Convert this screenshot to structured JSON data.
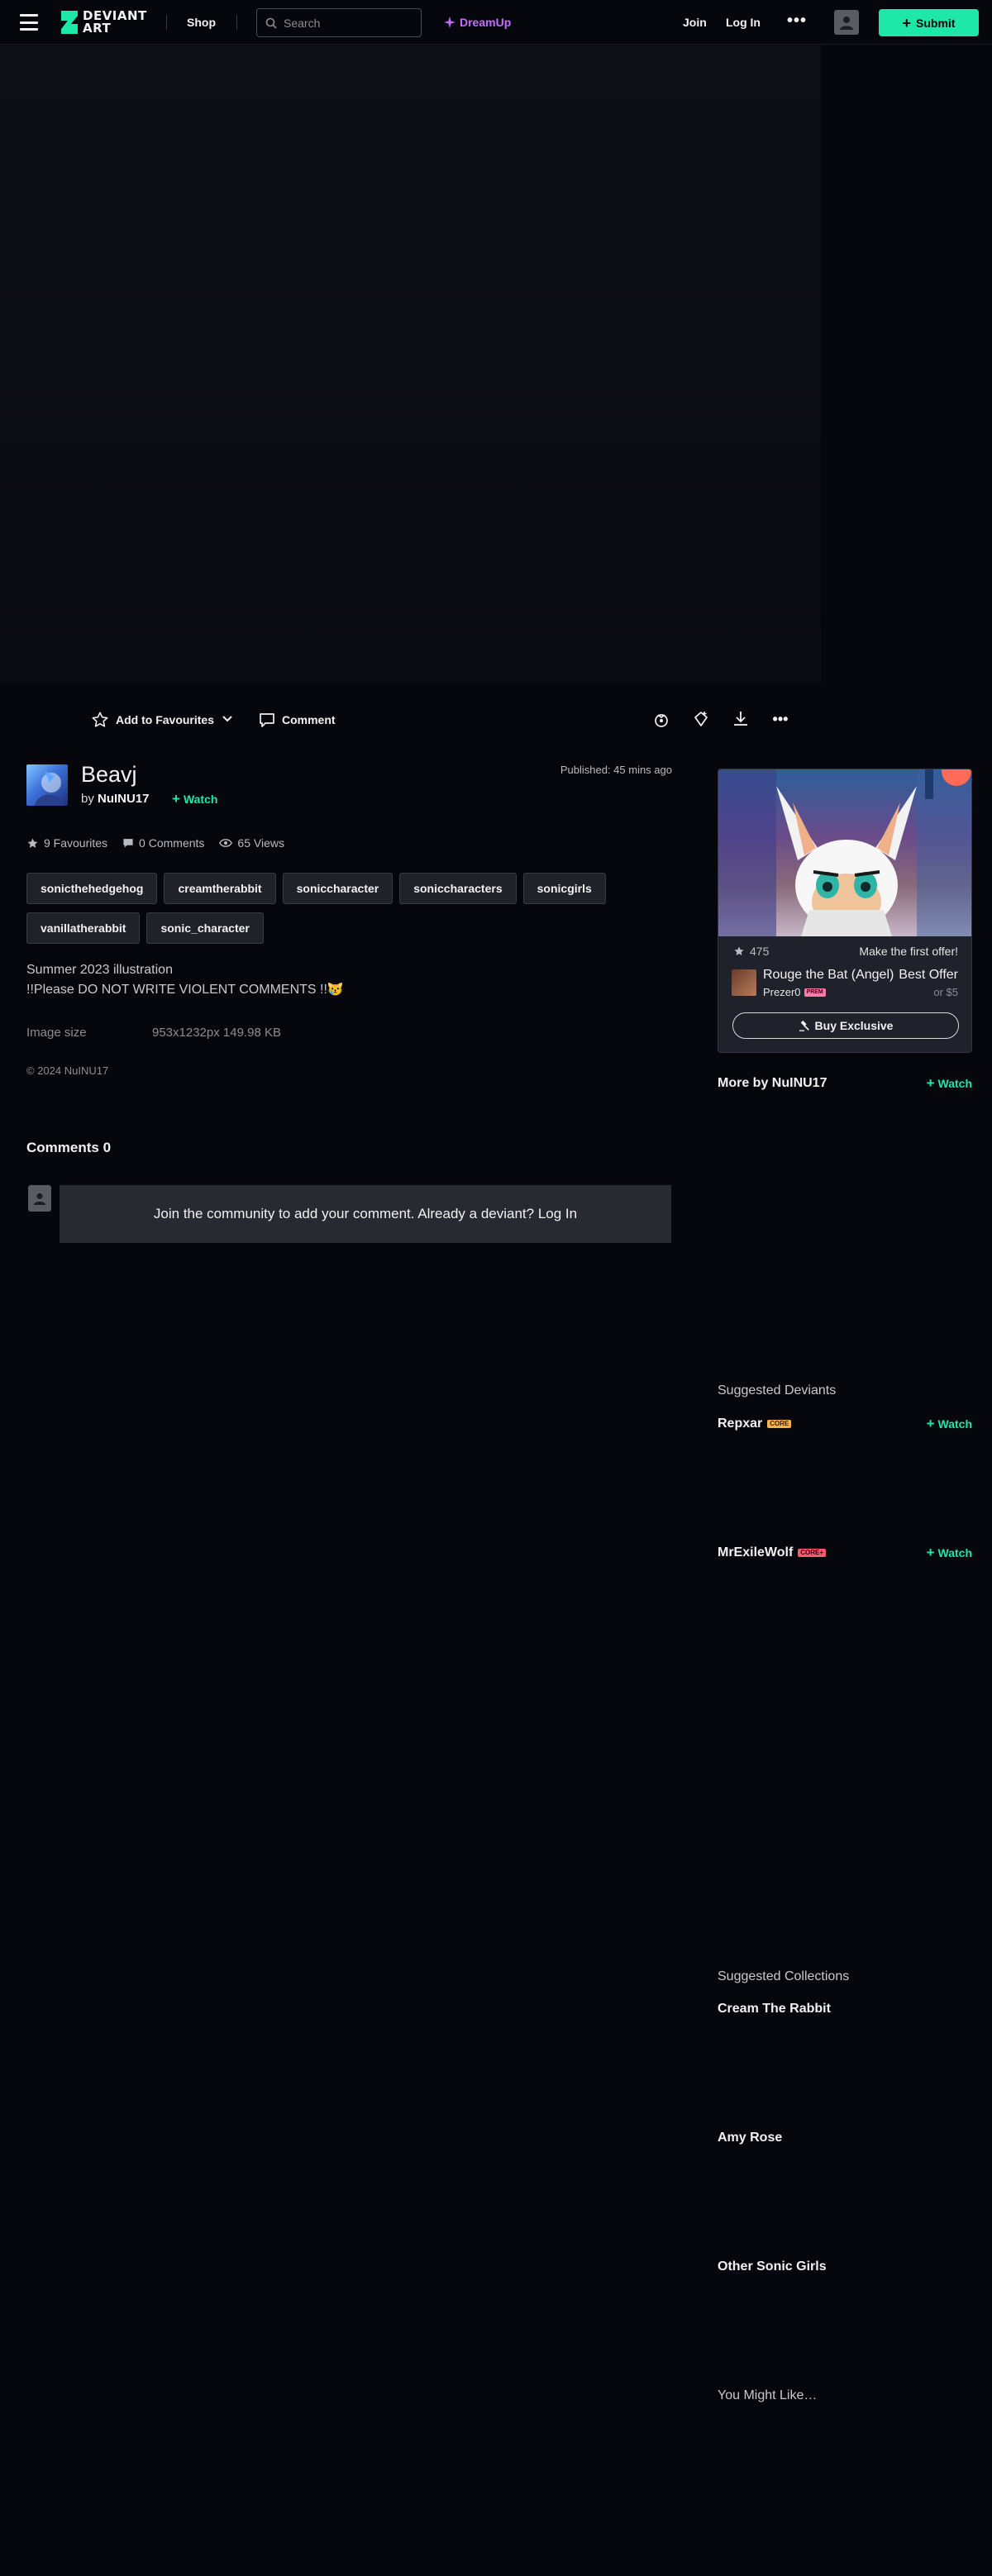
{
  "header": {
    "logo_line1": "DEVIANT",
    "logo_line2": "ART",
    "shop": "Shop",
    "search_placeholder": "Search",
    "dreamup": "DreamUp",
    "join": "Join",
    "login": "Log In",
    "submit": "Submit"
  },
  "actions": {
    "add_to_favourites": "Add to Favourites",
    "comment": "Comment"
  },
  "deviation": {
    "title": "Beavj",
    "by_prefix": "by",
    "author": "NuINU17",
    "watch": "Watch",
    "published": "Published: 45 mins ago",
    "favourites": "9 Favourites",
    "comments": "0 Comments",
    "views": "65 Views",
    "tags": [
      "sonicthehedgehog",
      "creamtherabbit",
      "soniccharacter",
      "soniccharacters",
      "sonicgirls",
      "vanillatherabbit",
      "sonic_character"
    ],
    "desc_line1": "Summer 2023 illustration",
    "desc_line2": "!!Please DO NOT WRITE VIOLENT COMMENTS !!😿",
    "image_size_label": "Image size",
    "image_size_value": "953x1232px 149.98 KB",
    "copyright": "© 2024 NuINU17"
  },
  "comments": {
    "heading": "Comments 0",
    "join_text": "Join the community to add your comment. Already a deviant? Log In"
  },
  "shop_card": {
    "favourites": "475",
    "offer_prompt": "Make the first offer!",
    "title": "Rouge the Bat (Angel)",
    "owner": "Prezer0",
    "owner_badge": "PREM",
    "price": "Best Offer",
    "alt_price": "or $5",
    "buy": "Buy Exclusive"
  },
  "sidebar": {
    "more_by": "More by NuINU17",
    "watch": "Watch",
    "suggested_deviants": "Suggested Deviants",
    "deviants": [
      {
        "name": "Repxar",
        "badge": "CORE"
      },
      {
        "name": "MrExileWolf",
        "badge": "CORE+"
      }
    ],
    "suggested_collections": "Suggested Collections",
    "collections": [
      "Cream The Rabbit",
      "Amy Rose",
      "Other Sonic Girls"
    ],
    "you_might_like": "You Might Like…"
  },
  "colors": {
    "accent": "#1ee8a7",
    "dreamup": "#c46dff",
    "background": "#06070d"
  }
}
